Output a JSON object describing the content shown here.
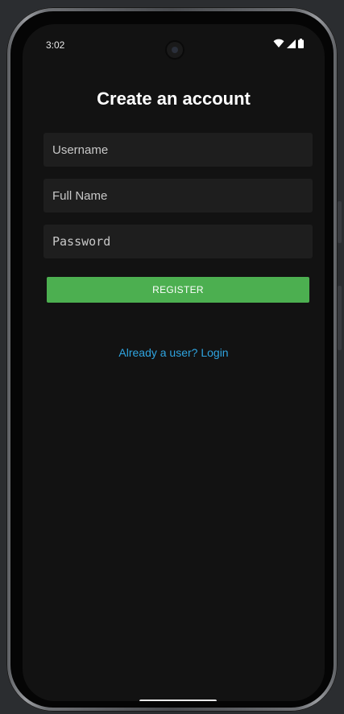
{
  "status_bar": {
    "time": "3:02",
    "icons": [
      "wifi-icon",
      "signal-icon",
      "battery-icon"
    ]
  },
  "screen": {
    "title": "Create an account",
    "fields": {
      "username_placeholder": "Username",
      "fullname_placeholder": "Full Name",
      "password_placeholder": "Password"
    },
    "register_label": "REGISTER",
    "login_link": "Already a user? Login"
  },
  "colors": {
    "background": "#121212",
    "field_background": "#1e1e1e",
    "accent_green": "#4caf50",
    "link_blue": "#2fa4e0"
  }
}
